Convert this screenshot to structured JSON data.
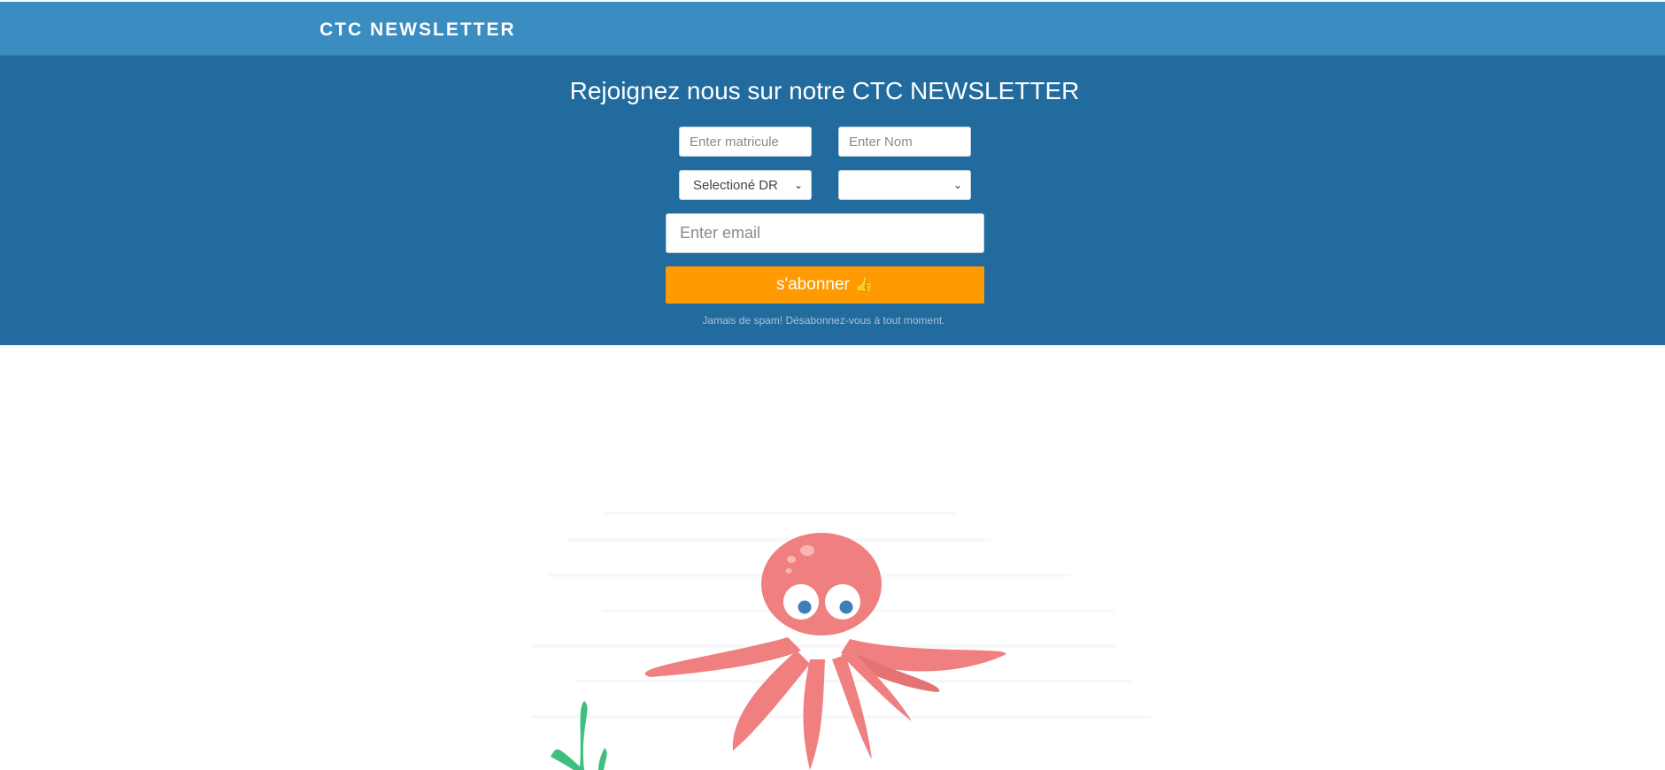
{
  "header": {
    "brand": "CTC NEWSLETTER"
  },
  "hero": {
    "headline": "Rejoignez nous sur notre CTC NEWSLETTER",
    "matricule_placeholder": "Enter matricule",
    "nom_placeholder": "Enter Nom",
    "dr_select_value": "Selectioné DR",
    "second_select_value": "",
    "email_placeholder": "Enter email",
    "subscribe_label": "s'abonner",
    "subscribe_icon": "thumbs-up-icon",
    "spam_note": "Jamais de spam! Désabonnez-vous à tout moment."
  },
  "colors": {
    "topbar": "#3a8dc0",
    "hero": "#226b9e",
    "button": "#ff9a00",
    "octopus": "#f08080",
    "seaweed": "#3fbf7f"
  }
}
